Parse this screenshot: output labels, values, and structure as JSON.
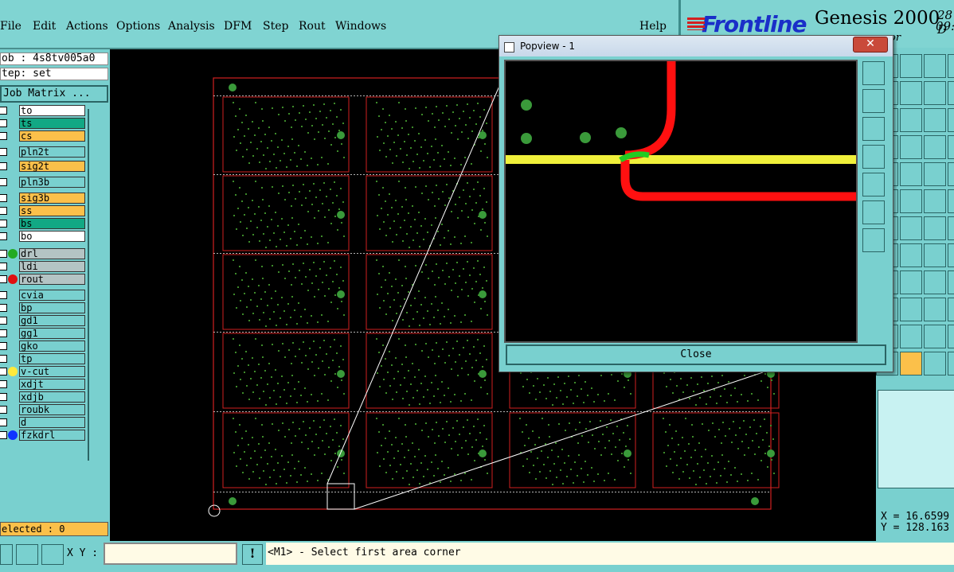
{
  "menubar": {
    "items": [
      "File",
      "Edit",
      "Actions",
      "Options",
      "Analysis",
      "DFM",
      "Step",
      "Rout",
      "Windows"
    ],
    "help": "Help"
  },
  "brand": {
    "logo": "Frontline",
    "product": "Genesis 2000",
    "date": "28 D",
    "time": "09:",
    "sub": "or"
  },
  "left": {
    "job": "ob : 4s8tv005a0",
    "step": "tep: set",
    "matrix_button": "Job Matrix ...",
    "selected": "elected : 0"
  },
  "layers": [
    {
      "name": "to",
      "color": "#ffffff",
      "dot": ""
    },
    {
      "name": "ts",
      "color": "#12a884",
      "dot": ""
    },
    {
      "name": "cs",
      "color": "#fbc04a",
      "dot": ""
    },
    {
      "name": "pln2t",
      "color": "#79d0cf",
      "dot": ""
    },
    {
      "name": "sig2t",
      "color": "#fbc04a",
      "dot": ""
    },
    {
      "name": "pln3b",
      "color": "#79d0cf",
      "dot": ""
    },
    {
      "name": "sig3b",
      "color": "#fbc04a",
      "dot": ""
    },
    {
      "name": "ss",
      "color": "#fbc04a",
      "dot": ""
    },
    {
      "name": "bs",
      "color": "#12a884",
      "dot": ""
    },
    {
      "name": "bo",
      "color": "#ffffff",
      "dot": ""
    },
    {
      "name": "drl",
      "color": "#b4c4c4",
      "dot": "#22aa22"
    },
    {
      "name": "ldi",
      "color": "#b4c4c4",
      "dot": ""
    },
    {
      "name": "rout",
      "color": "#b4c4c4",
      "dot": "#e01010"
    },
    {
      "name": "cvia",
      "color": "#79d0cf",
      "dot": ""
    },
    {
      "name": "bp",
      "color": "#79d0cf",
      "dot": ""
    },
    {
      "name": "gd1",
      "color": "#79d0cf",
      "dot": ""
    },
    {
      "name": "gg1",
      "color": "#79d0cf",
      "dot": ""
    },
    {
      "name": "gko",
      "color": "#79d0cf",
      "dot": ""
    },
    {
      "name": "tp",
      "color": "#79d0cf",
      "dot": ""
    },
    {
      "name": "v-cut",
      "color": "#79d0cf",
      "dot": "#ffe93a"
    },
    {
      "name": "xdjt",
      "color": "#79d0cf",
      "dot": ""
    },
    {
      "name": "xdjb",
      "color": "#79d0cf",
      "dot": ""
    },
    {
      "name": "roubk",
      "color": "#79d0cf",
      "dot": ""
    },
    {
      "name": "d",
      "color": "#79d0cf",
      "dot": ""
    },
    {
      "name": "fzkdrl",
      "color": "#79d0cf",
      "dot": "#1033ff"
    }
  ],
  "popview": {
    "title": "Popview - 1",
    "close_x": "✕",
    "close_button": "Close"
  },
  "coords": {
    "x": "X = 16.6599",
    "y": "Y = 128.163"
  },
  "status": {
    "xy_label": "X Y :",
    "xy_value": "",
    "message": "<M1> - Select first area corner"
  }
}
